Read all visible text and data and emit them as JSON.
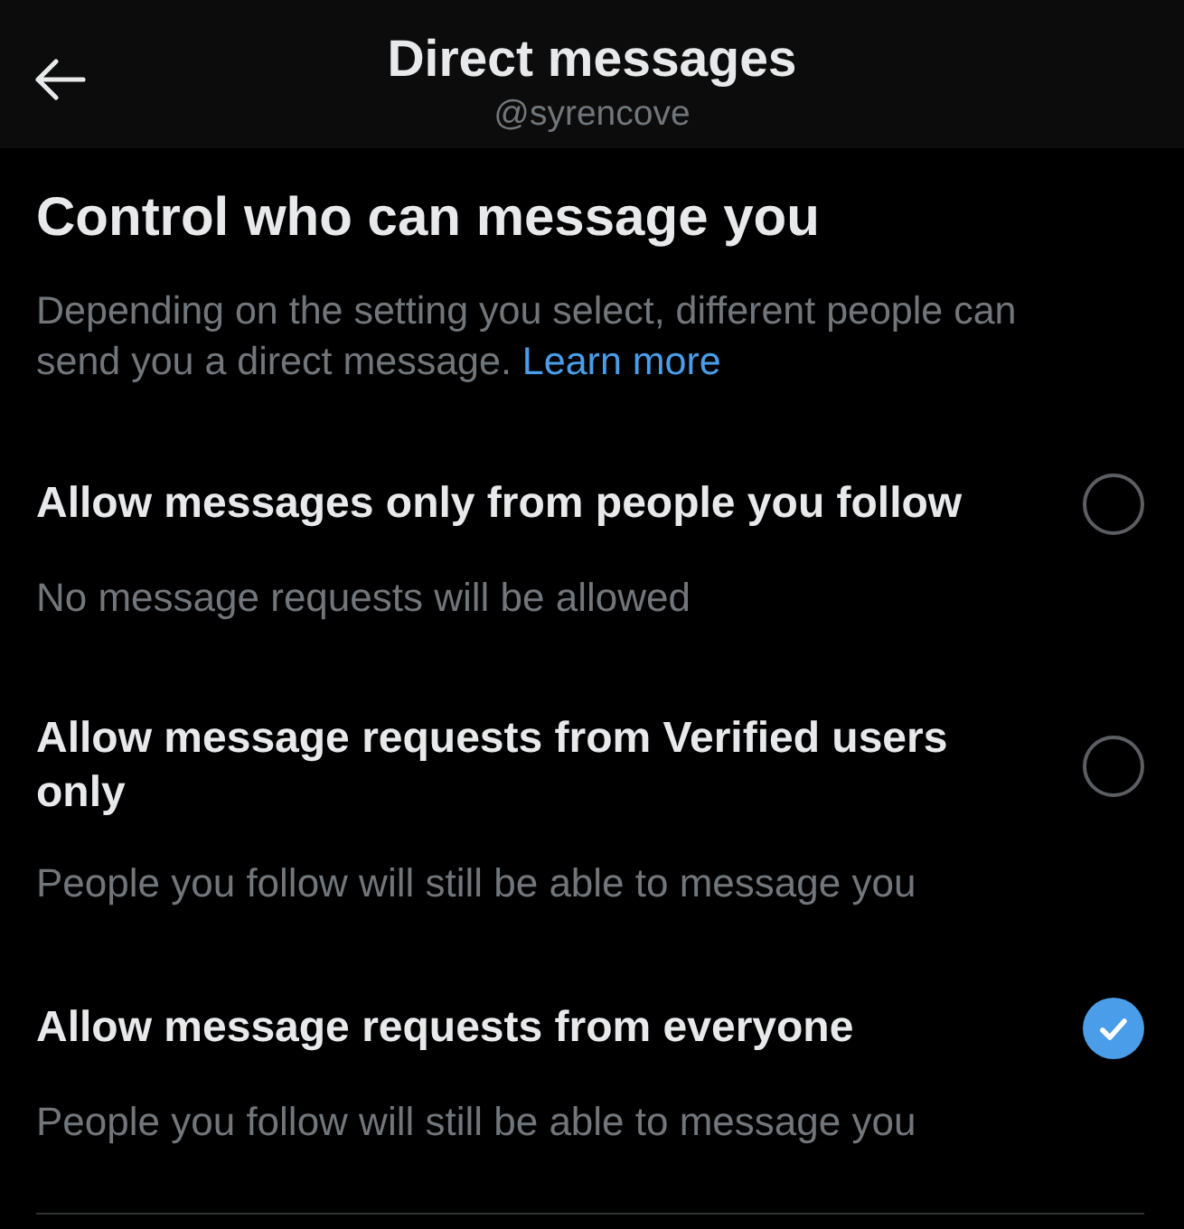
{
  "header": {
    "title": "Direct messages",
    "subtitle": "@syrencove"
  },
  "section": {
    "heading": "Control who can message you",
    "description": "Depending on the setting you select, different people can send you a direct message.",
    "link": "Learn more"
  },
  "options": [
    {
      "title": "Allow messages only from people you follow",
      "description": "No message requests will be allowed",
      "selected": false
    },
    {
      "title": "Allow message requests from Verified users only",
      "description": "People you follow will still be able to message you",
      "selected": false
    },
    {
      "title": "Allow message requests from everyone",
      "description": "People you follow will still be able to message you",
      "selected": true
    }
  ]
}
